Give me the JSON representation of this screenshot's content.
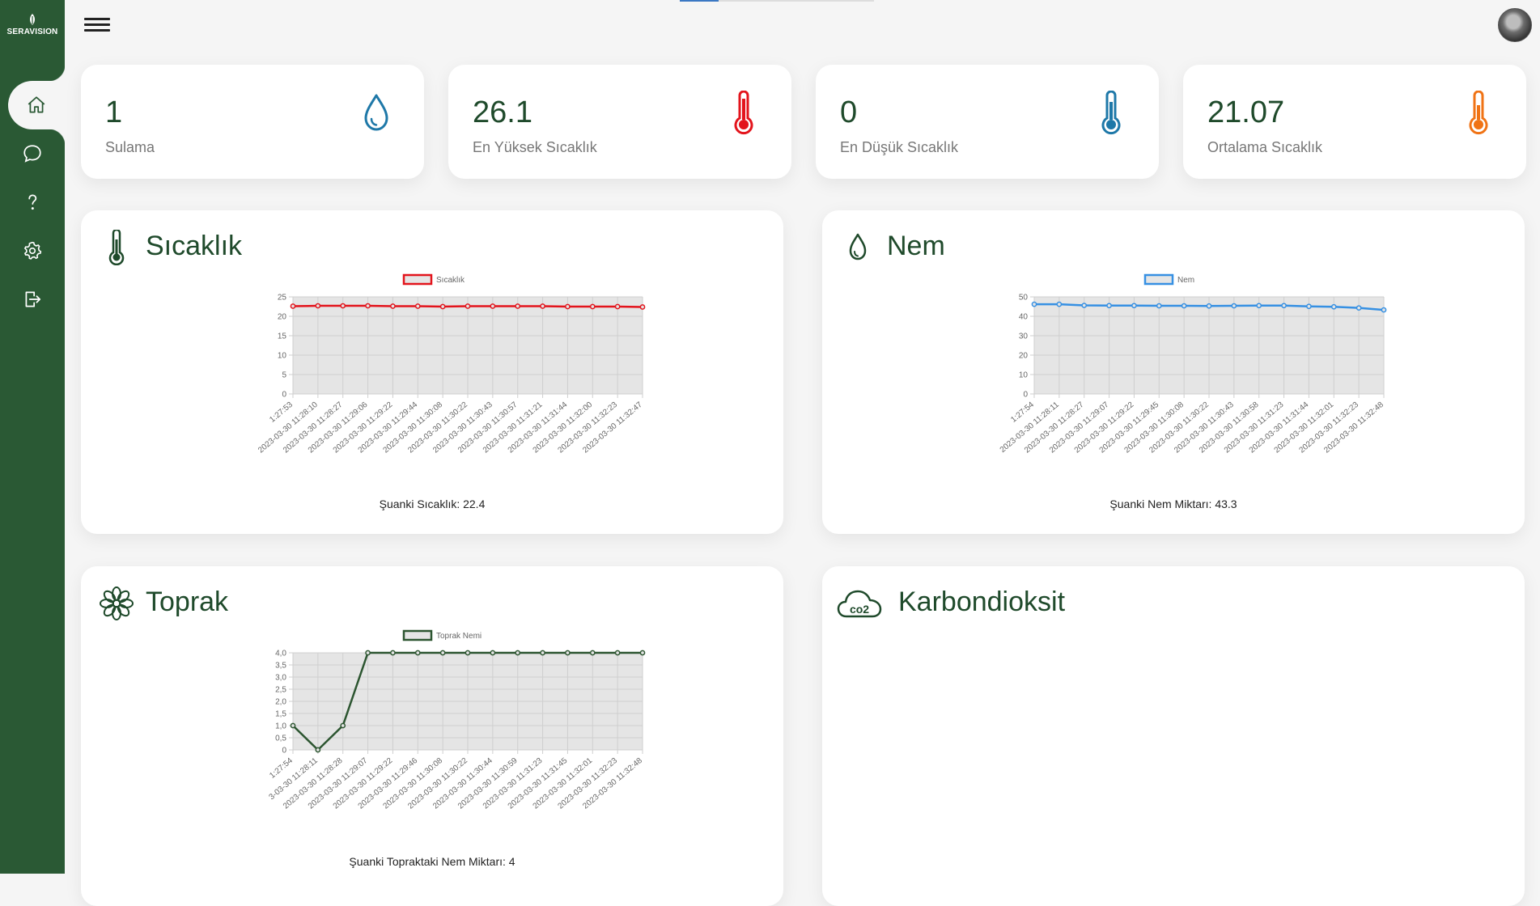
{
  "app": {
    "brand": "SERAVISION"
  },
  "sidebar": {
    "items": [
      {
        "name": "home",
        "icon": "home-icon"
      },
      {
        "name": "messages",
        "icon": "chat-icon"
      },
      {
        "name": "help",
        "icon": "question-icon"
      },
      {
        "name": "settings",
        "icon": "gear-icon"
      },
      {
        "name": "logout",
        "icon": "logout-icon"
      }
    ]
  },
  "colors": {
    "sidebar": "#2a5934",
    "accent": "#1f4a2b",
    "red": "#e3141c",
    "blue": "#3690e3",
    "dark_green": "#2c5530",
    "orange": "#f07315"
  },
  "stats": [
    {
      "value": "1",
      "label": "Sulama",
      "icon": "water-drop-icon"
    },
    {
      "value": "26.1",
      "label": "En Yüksek Sıcaklık",
      "icon": "thermometer-high-icon"
    },
    {
      "value": "0",
      "label": "En Düşük Sıcaklık",
      "icon": "thermometer-low-icon"
    },
    {
      "value": "21.07",
      "label": "Ortalama Sıcaklık",
      "icon": "thermometer-mid-icon"
    }
  ],
  "panels": {
    "sicaklik": {
      "title": "Sıcaklık",
      "caption": "Şuanki Sıcaklık: 22.4"
    },
    "nem": {
      "title": "Nem",
      "caption": "Şuanki Nem Miktarı: 43.3"
    },
    "toprak": {
      "title": "Toprak",
      "caption": "Şuanki Topraktaki Nem Miktarı: 4"
    },
    "karbondioksit": {
      "title": "Karbondioksit"
    }
  },
  "chart_data": [
    {
      "type": "line",
      "categories": [
        "1:27:53",
        "2023-03-30 11:28:10",
        "2023-03-30 11:28:27",
        "2023-03-30 11:29:06",
        "2023-03-30 11:29:22",
        "2023-03-30 11:29:44",
        "2023-03-30 11:30:08",
        "2023-03-30 11:30:22",
        "2023-03-30 11:30:43",
        "2023-03-30 11:30:57",
        "2023-03-30 11:31:21",
        "2023-03-30 11:31:44",
        "2023-03-30 11:32:00",
        "2023-03-30 11:32:23",
        "2023-03-30 11:32:47"
      ],
      "series": [
        {
          "name": "Sıcaklık",
          "values": [
            22.6,
            22.7,
            22.7,
            22.7,
            22.6,
            22.6,
            22.5,
            22.6,
            22.6,
            22.6,
            22.6,
            22.5,
            22.5,
            22.5,
            22.4
          ],
          "color": "#e3141c"
        }
      ],
      "ylim": [
        0,
        25
      ],
      "yticks": [
        "0",
        "5",
        "10",
        "15",
        "20",
        "25"
      ],
      "legend": "top",
      "grid": true
    },
    {
      "type": "line",
      "categories": [
        "1:27:54",
        "2023-03-30 11:28:11",
        "2023-03-30 11:28:27",
        "2023-03-30 11:29:07",
        "2023-03-30 11:29:22",
        "2023-03-30 11:29:45",
        "2023-03-30 11:30:08",
        "2023-03-30 11:30:22",
        "2023-03-30 11:30:43",
        "2023-03-30 11:30:58",
        "2023-03-30 11:31:23",
        "2023-03-30 11:31:44",
        "2023-03-30 11:32:01",
        "2023-03-30 11:32:23",
        "2023-03-30 11:32:48"
      ],
      "series": [
        {
          "name": "Nem",
          "values": [
            46.2,
            46.2,
            45.6,
            45.5,
            45.5,
            45.4,
            45.4,
            45.3,
            45.4,
            45.5,
            45.5,
            45.1,
            44.9,
            44.3,
            43.3
          ],
          "color": "#3690e3"
        }
      ],
      "ylim": [
        0,
        50
      ],
      "yticks": [
        "0",
        "10",
        "20",
        "30",
        "40",
        "50"
      ],
      "legend": "top",
      "grid": true
    },
    {
      "type": "line",
      "categories": [
        "1:27:54",
        "3-03-30 11:28:11",
        "2023-03-30 11:28:28",
        "2023-03-30 11:29:07",
        "2023-03-30 11:29:22",
        "2023-03-30 11:29:46",
        "2023-03-30 11:30:08",
        "2023-03-30 11:30:22",
        "2023-03-30 11:30:44",
        "2023-03-30 11:30:59",
        "2023-03-30 11:31:23",
        "2023-03-30 11:31:45",
        "2023-03-30 11:32:01",
        "2023-03-30 11:32:23",
        "2023-03-30 11:32:48"
      ],
      "series": [
        {
          "name": "Toprak Nemi",
          "values": [
            1,
            0,
            1,
            4,
            4,
            4,
            4,
            4,
            4,
            4,
            4,
            4,
            4,
            4,
            4
          ],
          "color": "#2c5530"
        }
      ],
      "ylim": [
        0,
        4
      ],
      "yticks": [
        "0",
        "0,5",
        "1,0",
        "1,5",
        "2,0",
        "2,5",
        "3,0",
        "3,5",
        "4,0"
      ],
      "legend": "top",
      "grid": true
    }
  ]
}
